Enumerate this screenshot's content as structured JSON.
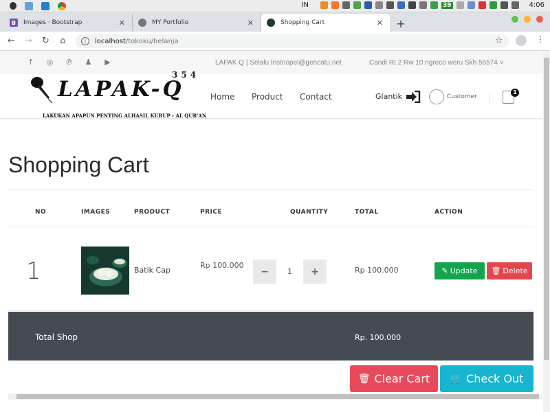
{
  "os": {
    "lang": "IN",
    "time": "4:06",
    "tray_badge": "39"
  },
  "browser": {
    "tabs": [
      {
        "label": "Images · Bootstrap",
        "icon": "bootstrap-icon"
      },
      {
        "label": "MY Portfolio",
        "icon": "globe-icon"
      },
      {
        "label": "Shopping Cart",
        "icon": "leaf-icon"
      }
    ],
    "url_host": "localhost",
    "url_path": "/tokoku/belanja"
  },
  "site": {
    "tagline": "LAPAK Q | Selalu Instnopel@gencatu.net",
    "address": "Candi Rt 2 Rw 10 ngreco weru Skh 56574 ˅",
    "brand": "LAPAK-Q",
    "brand_num": "354",
    "brand_tagline": "LAKUKAN APAPUN PENTING ALHASIL KURUP - AL QUR'AN",
    "nav": [
      "Home",
      "Product",
      "Contact"
    ],
    "login_label": "Glantik",
    "customer_label": "Customer",
    "cart_count": "1"
  },
  "page": {
    "title": "Shopping Cart",
    "columns": [
      "NO",
      "IMAGES",
      "PRODUCT",
      "PRICE",
      "QUANTITY",
      "TOTAL",
      "ACTION"
    ],
    "rows": [
      {
        "no": "1",
        "product": "Batik Cap",
        "price": "Rp 100.000",
        "qty": "1",
        "total": "Rp 100.000"
      }
    ],
    "update_label": "Update",
    "delete_label": "Delete",
    "footer_label": "Total Shop",
    "footer_total": "Rp. 100.000",
    "clear_label": "Clear Cart",
    "checkout_label": "Check Out"
  },
  "colors": {
    "update": "#14a44d",
    "delete": "#e2474f",
    "clear": "#e84a5c",
    "checkout": "#17b5cf",
    "footer": "#454b52"
  }
}
